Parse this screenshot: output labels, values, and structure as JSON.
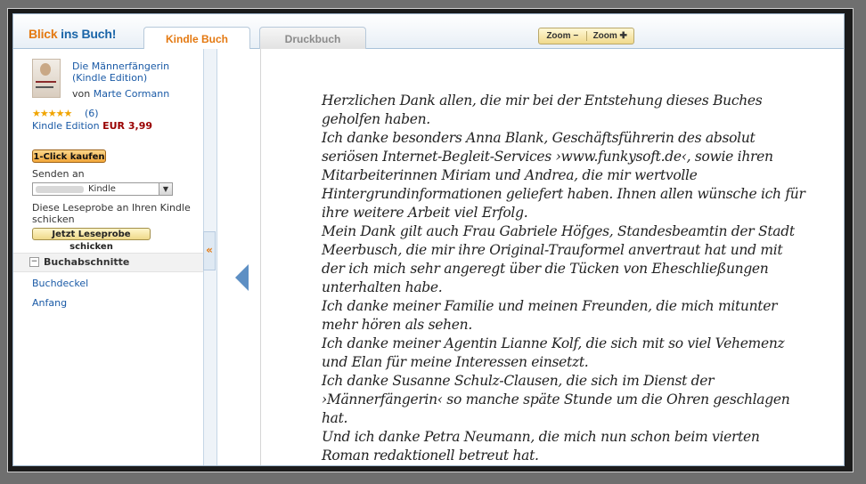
{
  "header": {
    "logo_part1": "Blick",
    "logo_part2": "ins Buch!",
    "tabs": [
      {
        "label": "Kindle Buch",
        "active": true
      },
      {
        "label": "Druckbuch",
        "active": false
      }
    ],
    "zoom_out_label": "Zoom −",
    "zoom_in_label": "Zoom ✚"
  },
  "sidebar": {
    "book_title_line1": "Die Männerfängerin",
    "book_title_line2": "(Kindle Edition)",
    "author_prefix": "von",
    "author": "Marte Cormann",
    "rating_stars": "★★★★★",
    "rating_count": "(6)",
    "edition": "Kindle Edition",
    "price": "EUR 3,99",
    "buy_button": "1-Click kaufen",
    "send_to_label": "Senden an",
    "device_select_value": "Kindle",
    "sample_text_line1": "Diese Leseprobe an Ihren Kindle",
    "sample_text_line2": "schicken",
    "send_sample_button": "Jetzt Leseprobe schicken",
    "sections_title": "Buchabschnitte",
    "sections": [
      "Buchdeckel",
      "Anfang"
    ],
    "collapse_glyph": "«"
  },
  "page": {
    "lines": [
      "Herzlichen Dank allen, die mir bei der Entstehung dieses Buches",
      "geholfen haben.",
      "Ich danke besonders Anna Blank, Geschäftsführerin des absolut",
      "seriösen Internet-Begleit-Services ›www.funkysoft.de‹, sowie ihren",
      "Mitarbeiterinnen Miriam und Andrea, die mir wertvolle",
      "Hintergrundinformationen geliefert haben. Ihnen allen wünsche ich für",
      "ihre weitere Arbeit viel Erfolg.",
      "Mein Dank gilt auch Frau Gabriele Höfges, Standesbeamtin der Stadt",
      "Meerbusch, die mir ihre Original-Trauformel anvertraut hat und mit",
      "der ich mich sehr angeregt über die Tücken von Eheschließungen",
      "unterhalten habe.",
      "Ich danke meiner Familie und meinen Freunden, die mich mitunter",
      "mehr hören als sehen.",
      "Ich danke meiner Agentin Lianne Kolf, die sich mit so viel Vehemenz",
      "und Elan für meine Interessen einsetzt.",
      "Ich danke Susanne Schulz-Clausen, die sich im Dienst der",
      "›Männerfängerin‹ so manche späte Stunde um die Ohren geschlagen",
      "hat.",
      "Und ich danke Petra Neumann, die mich nun schon beim vierten",
      "Roman redaktionell betreut hat."
    ]
  },
  "colors": {
    "accent_orange": "#e47911",
    "link_blue": "#1a5aa6",
    "price_red": "#990000",
    "nav_arrow": "#5d8fc4"
  }
}
